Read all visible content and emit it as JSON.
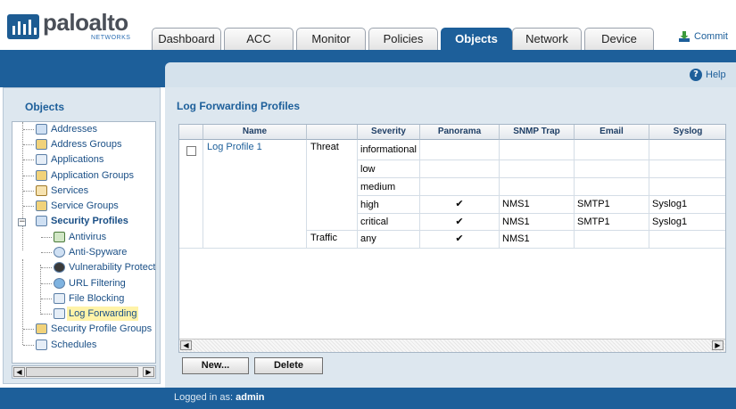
{
  "brand": {
    "name": "paloalto",
    "tagline": "NETWORKS"
  },
  "colors": {
    "primary": "#1d5f9a",
    "panel": "#dde7ef",
    "selected_highlight": "#fff3a8"
  },
  "tabs": [
    {
      "label": "Dashboard",
      "active": false
    },
    {
      "label": "ACC",
      "active": false
    },
    {
      "label": "Monitor",
      "active": false
    },
    {
      "label": "Policies",
      "active": false
    },
    {
      "label": "Objects",
      "active": true
    },
    {
      "label": "Network",
      "active": false
    },
    {
      "label": "Device",
      "active": false
    }
  ],
  "commit": {
    "label": "Commit",
    "icon": "commit-download-icon"
  },
  "help": {
    "label": "Help",
    "icon": "help-circle-icon"
  },
  "sidebar": {
    "title": "Objects",
    "items": [
      {
        "label": "Addresses",
        "icon": "address-icon",
        "level": 1
      },
      {
        "label": "Address Groups",
        "icon": "address-group-icon",
        "level": 1
      },
      {
        "label": "Applications",
        "icon": "application-icon",
        "level": 1
      },
      {
        "label": "Application Groups",
        "icon": "application-group-icon",
        "level": 1
      },
      {
        "label": "Services",
        "icon": "services-icon",
        "level": 1
      },
      {
        "label": "Service Groups",
        "icon": "service-group-icon",
        "level": 1
      },
      {
        "label": "Security Profiles",
        "icon": "security-profile-icon",
        "level": 1,
        "expanded": true
      },
      {
        "label": "Antivirus",
        "icon": "antivirus-icon",
        "level": 2
      },
      {
        "label": "Anti-Spyware",
        "icon": "anti-spyware-icon",
        "level": 2
      },
      {
        "label": "Vulnerability Protection",
        "icon": "vulnerability-icon",
        "level": 2
      },
      {
        "label": "URL Filtering",
        "icon": "url-filtering-icon",
        "level": 2
      },
      {
        "label": "File Blocking",
        "icon": "file-blocking-icon",
        "level": 2
      },
      {
        "label": "Log Forwarding",
        "icon": "log-forwarding-icon",
        "level": 2,
        "selected": true
      },
      {
        "label": "Security Profile Groups",
        "icon": "profile-group-icon",
        "level": 1
      },
      {
        "label": "Schedules",
        "icon": "schedule-icon",
        "level": 1
      }
    ]
  },
  "main": {
    "title": "Log Forwarding Profiles",
    "columns": [
      "Name",
      "",
      "Severity",
      "Panorama",
      "SNMP Trap",
      "Email",
      "Syslog"
    ],
    "profile": {
      "name": "Log Profile 1",
      "groups": [
        {
          "type": "Threat",
          "rows": [
            {
              "severity": "informational",
              "panorama": "",
              "snmp": "",
              "email": "",
              "syslog": ""
            },
            {
              "severity": "low",
              "panorama": "",
              "snmp": "",
              "email": "",
              "syslog": ""
            },
            {
              "severity": "medium",
              "panorama": "",
              "snmp": "",
              "email": "",
              "syslog": ""
            },
            {
              "severity": "high",
              "panorama": "✔",
              "snmp": "NMS1",
              "email": "SMTP1",
              "syslog": "Syslog1"
            },
            {
              "severity": "critical",
              "panorama": "✔",
              "snmp": "NMS1",
              "email": "SMTP1",
              "syslog": "Syslog1"
            }
          ]
        },
        {
          "type": "Traffic",
          "rows": [
            {
              "severity": "any",
              "panorama": "✔",
              "snmp": "NMS1",
              "email": "",
              "syslog": ""
            }
          ]
        }
      ]
    },
    "buttons": {
      "new": "New...",
      "delete": "Delete"
    }
  },
  "status": {
    "prefix": "Logged in as:",
    "user": "admin"
  }
}
